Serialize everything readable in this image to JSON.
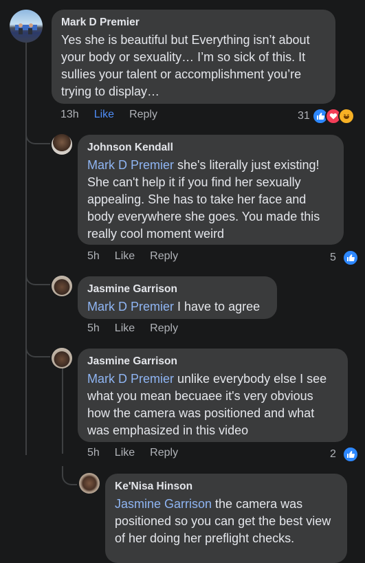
{
  "comments": [
    {
      "author": "Mark D Premier",
      "mention": "",
      "text": "Yes she is beautiful but Everything isn’t about your body or sexuality… I’m so sick of this. It sullies your talent or accomplishment you’re trying to display…",
      "time": "13h",
      "like": "Like",
      "reply": "Reply",
      "count": "31",
      "reactions": [
        "like-icon",
        "love-icon",
        "haha-icon"
      ]
    },
    {
      "author": "Johnson Kendall",
      "mention": "Mark D Premier",
      "text": " she's literally just existing! She can't help it if you find her sexually appealing. She has to take her face and body everywhere she goes. You made this really cool moment weird",
      "time": "5h",
      "like": "Like",
      "reply": "Reply",
      "count": "5",
      "reactions": [
        "like-icon"
      ]
    },
    {
      "author": "Jasmine Garrison",
      "mention": "Mark D Premier",
      "text": " I have to agree",
      "time": "5h",
      "like": "Like",
      "reply": "Reply"
    },
    {
      "author": "Jasmine Garrison",
      "mention": "Mark D Premier",
      "text": " unlike everybody else I see what you mean becuaee it's very obvious how the camera was positioned and what was emphasized in this video",
      "time": "5h",
      "like": "Like",
      "reply": "Reply",
      "count": "2",
      "reactions": [
        "like-icon"
      ]
    },
    {
      "author": "Ke'Nisa Hinson",
      "mention": "Jasmine Garrison",
      "text": " the camera was positioned so you can get the best view of her doing her preflight checks."
    }
  ],
  "colors": {
    "mention": "#8fb5f3",
    "like_active": "#4f8df7",
    "bubble": "#3a3b3c",
    "background": "#18191a"
  }
}
